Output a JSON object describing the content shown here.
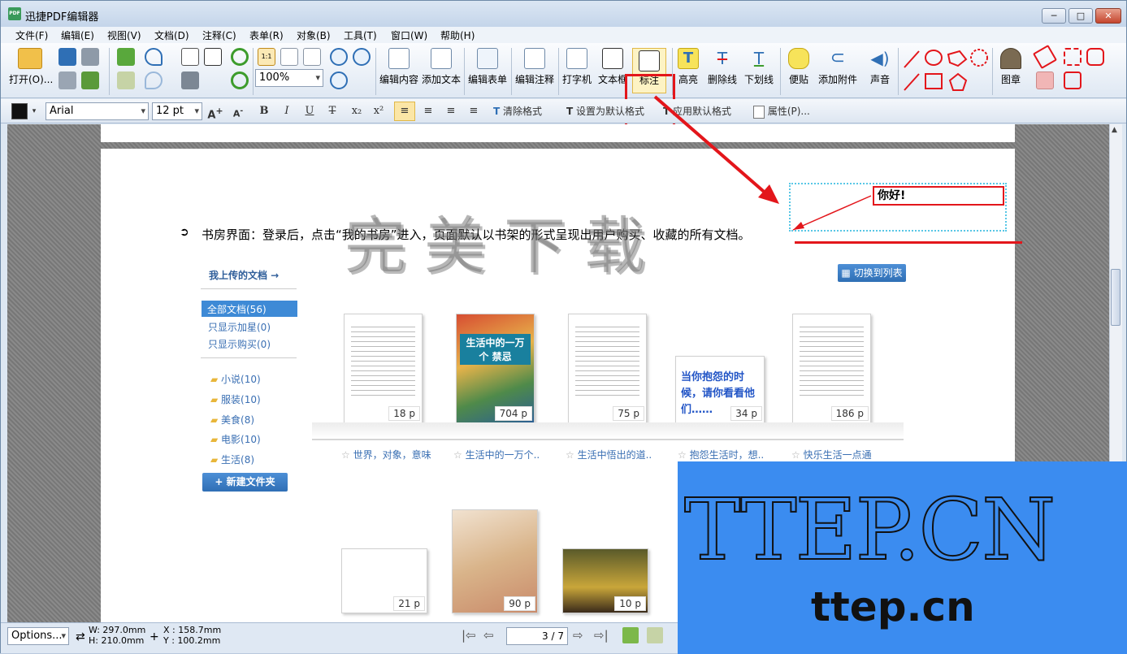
{
  "window": {
    "title": "迅捷PDF编辑器",
    "app_icon": "PDF",
    "minimize": "─",
    "maximize": "□",
    "close": "✕"
  },
  "menu": [
    "文件(F)",
    "编辑(E)",
    "视图(V)",
    "文档(D)",
    "注释(C)",
    "表单(R)",
    "对象(B)",
    "工具(T)",
    "窗口(W)",
    "帮助(H)"
  ],
  "toolbar": {
    "open": "打开(O)...",
    "zoom": "100%",
    "edit_content": "编辑内容",
    "add_text": "添加文本",
    "edit_form": "编辑表单",
    "edit_annotation": "编辑注释",
    "typewriter": "打字机",
    "textbox": "文本框",
    "callout": "标注",
    "highlight": "高亮",
    "strikeout": "删除线",
    "underline": "下划线",
    "note": "便贴",
    "attach": "添加附件",
    "sound": "声音",
    "stamp": "图章"
  },
  "format": {
    "font": "Arial",
    "size": "12 pt",
    "bold": "B",
    "italic": "I",
    "underline": "U",
    "strike": "T",
    "sub": "x₂",
    "sup": "x²",
    "clear": "清除格式",
    "set_default": "设置为默认格式",
    "apply_default": "应用默认格式",
    "properties": "属性(P)..."
  },
  "doc": {
    "bullet": "➲",
    "paragraph": "书房界面：登录后，点击“我的书房”进入，页面默认以书架的形式呈现出用户购买、收藏的所有文档。",
    "watermark": "完美下载",
    "annotation": "你好!",
    "my_uploads": "我上传的文档 →",
    "switch_view": "切换到列表",
    "filters": [
      "全部文档(56)",
      "只显示加星(0)",
      "只显示购买(0)"
    ],
    "folders": [
      "小说(10)",
      "服装(10)",
      "美食(8)",
      "电影(10)",
      "生活(8)"
    ],
    "new_folder": "+ 新建文件夹",
    "books_row1": [
      {
        "pages": "18 p",
        "caption": "世界，对象，意味",
        "cover_text": ""
      },
      {
        "pages": "704 p",
        "caption": "生活中的一万个..",
        "cover_text": "生活中的一万个 禁忌"
      },
      {
        "pages": "75 p",
        "caption": "生活中悟出的道..",
        "cover_text": ""
      },
      {
        "pages": "34 p",
        "caption": "抱怨生活时，想..",
        "cover_text": "当你抱怨的时候，请你看看他们……"
      },
      {
        "pages": "186 p",
        "caption": "快乐生活一点通",
        "cover_text": ""
      }
    ],
    "books_row2": [
      {
        "pages": "21 p"
      },
      {
        "pages": "90 p"
      },
      {
        "pages": "10 p"
      }
    ]
  },
  "banner": {
    "big": "TTEP.CN",
    "small": "ttep.cn"
  },
  "status": {
    "options": "Options...",
    "w": "W: 297.0mm",
    "h": "H: 210.0mm",
    "x": "X : 158.7mm",
    "y": "Y : 100.2mm",
    "page": "3 / 7"
  },
  "colors": {
    "accent_red": "#e3161b",
    "banner_blue": "#3b8cf0",
    "link_blue": "#3a6fb3"
  }
}
